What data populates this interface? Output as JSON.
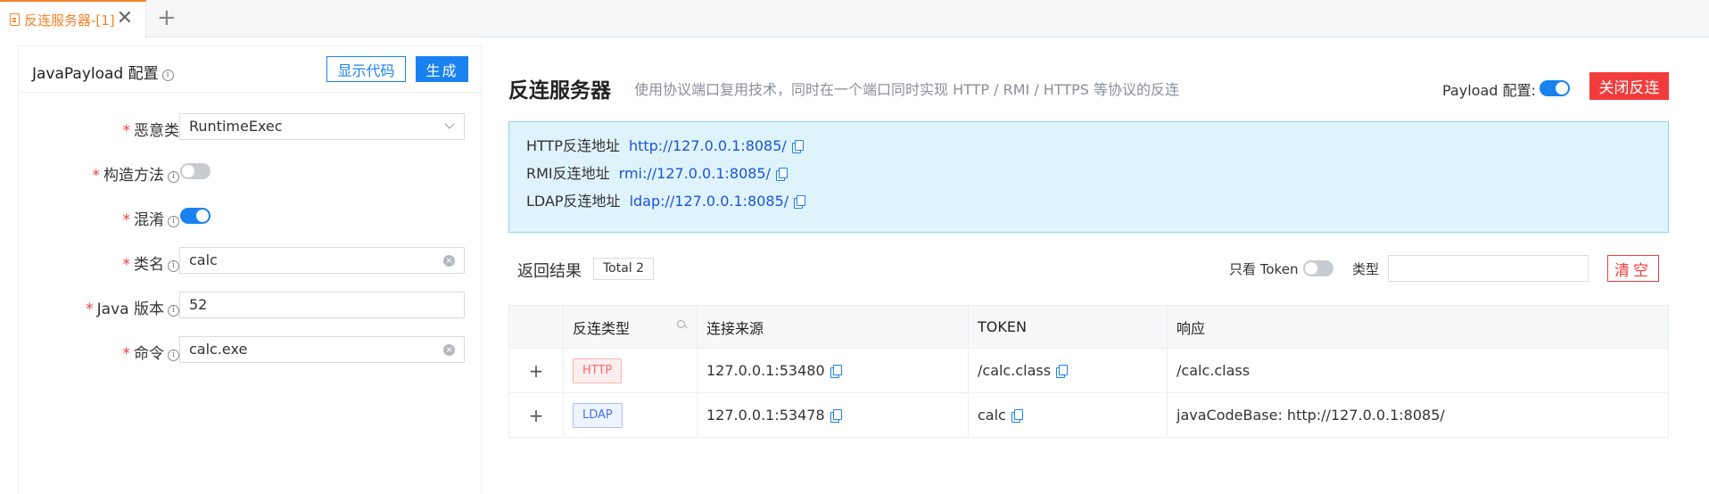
{
  "tab": {
    "label": "反连服务器-[1]",
    "close": "✕",
    "add": "+"
  },
  "left": {
    "title": "JavaPayload 配置",
    "show_code": "显示代码",
    "generate": "生成",
    "fields": {
      "gadget": {
        "label": "恶意类",
        "value": "RuntimeExec"
      },
      "ctor": {
        "label": "构造方法",
        "enabled": false
      },
      "obfuscate": {
        "label": "混淆",
        "enabled": true
      },
      "classname": {
        "label": "类名",
        "value": "calc"
      },
      "java_version": {
        "label": "Java 版本",
        "value": "52"
      },
      "command": {
        "label": "命令",
        "value": "calc.exe"
      }
    },
    "required_mark": "*",
    "info_mark": "i"
  },
  "right": {
    "title": "反连服务器",
    "subtitle": "使用协议端口复用技术，同时在一个端口同时实现 HTTP / RMI / HTTPS 等协议的反连",
    "payload_label": "Payload 配置:",
    "payload_enabled": true,
    "close_btn": "关闭反连",
    "addresses": [
      {
        "label": "HTTP反连地址",
        "url": "http://127.0.0.1:8085/"
      },
      {
        "label": "RMI反连地址",
        "url": "rmi://127.0.0.1:8085/"
      },
      {
        "label": "LDAP反连地址",
        "url": "ldap://127.0.0.1:8085/"
      }
    ],
    "results_label": "返回结果",
    "total": "Total 2",
    "token_only": "只看 Token",
    "type_label": "类型",
    "type_value": "",
    "clear_btn": "清空",
    "columns": [
      "反连类型",
      "连接来源",
      "TOKEN",
      "响应"
    ],
    "rows": [
      {
        "type": "HTTP",
        "source": "127.0.0.1:53480",
        "token": "/calc.class",
        "response": "/calc.class"
      },
      {
        "type": "LDAP",
        "source": "127.0.0.1:53478",
        "token": "calc",
        "response": "javaCodeBase: http://127.0.0.1:8085/"
      }
    ]
  },
  "colors": {
    "accent": "#1a82f0",
    "danger": "#f23b3b",
    "tab_active": "#f5822a",
    "info_bg": "#dff3fc",
    "http_tag_bg": "#fdeeee",
    "http_tag_text": "#f56c6c",
    "http_tag_border": "#f8b4b4",
    "ldap_tag_bg": "#edf3ff",
    "ldap_tag_text": "#4a74e0",
    "ldap_tag_border": "#a8c2f5"
  }
}
